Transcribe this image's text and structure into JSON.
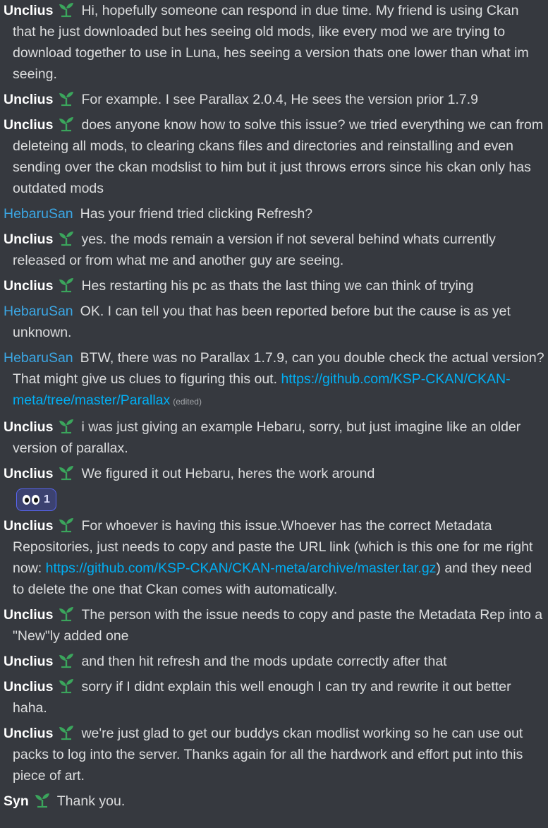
{
  "messages": [
    {
      "author": "Unclius",
      "badge": true,
      "mod": false,
      "text": "Hi, hopefully someone can respond in due time. My friend is using Ckan that he just downloaded but hes seeing old mods, like every mod we are trying to download together to use in Luna, hes seeing a version thats one lower than what im seeing."
    },
    {
      "author": "Unclius",
      "badge": true,
      "mod": false,
      "text": "For example. I see Parallax 2.0.4, He sees the version prior 1.7.9"
    },
    {
      "author": "Unclius",
      "badge": true,
      "mod": false,
      "text": "does anyone know how to solve this issue? we tried everything we can from deleteing all mods, to clearing ckans files and directories and reinstalling and even sending over the ckan modslist to him but it just throws errors since his ckan only has outdated mods"
    },
    {
      "author": "HebaruSan",
      "badge": false,
      "mod": true,
      "text": "Has your friend tried clicking Refresh?"
    },
    {
      "author": "Unclius",
      "badge": true,
      "mod": false,
      "text": "yes. the mods remain a version if not several behind whats currently released or from what me and another guy are seeing."
    },
    {
      "author": "Unclius",
      "badge": true,
      "mod": false,
      "text": "Hes restarting his pc as thats the last thing we can think of trying"
    },
    {
      "author": "HebaruSan",
      "badge": false,
      "mod": true,
      "text": "OK. I can tell you that has been reported before but the cause is as yet unknown."
    },
    {
      "author": "HebaruSan",
      "badge": false,
      "mod": true,
      "text": "BTW, there was no Parallax 1.7.9, can you double check the actual version? That might give us clues to figuring this out.",
      "link": "https://github.com/KSP-CKAN/CKAN-meta/tree/master/Parallax",
      "edited": "(edited)"
    },
    {
      "author": "Unclius",
      "badge": true,
      "mod": false,
      "text": "i was just giving an example Hebaru, sorry, but just imagine like an older version of parallax."
    },
    {
      "author": "Unclius",
      "badge": true,
      "mod": false,
      "text": "We figured it out Hebaru, heres the work around",
      "reaction": {
        "emoji": "eyes",
        "count": "1"
      }
    },
    {
      "author": "Unclius",
      "badge": true,
      "mod": false,
      "text": "For whoever is having this issue.Whoever has the correct Metadata Repositories, just needs to copy and paste the URL link (which is this one for me right now:",
      "link": "https://github.com/KSP-CKAN/CKAN-meta/archive/master.tar.gz",
      "after": ") and they need to delete the one that Ckan comes with automatically."
    },
    {
      "author": "Unclius",
      "badge": true,
      "mod": false,
      "text": "The person with the issue needs to copy and paste the Metadata Rep into a \"New\"ly added one"
    },
    {
      "author": "Unclius",
      "badge": true,
      "mod": false,
      "text": "and then hit refresh and the mods update correctly after that"
    },
    {
      "author": "Unclius",
      "badge": true,
      "mod": false,
      "text": "sorry if I didnt explain this well enough I can try and rewrite it out better haha."
    },
    {
      "author": "Unclius",
      "badge": true,
      "mod": false,
      "text": "we're just glad to get our buddys ckan modlist working so he can use out packs to log into the server. Thanks again for all the hardwork and effort put into this piece of art."
    },
    {
      "author": "Syn",
      "badge": true,
      "mod": false,
      "text": "Thank you."
    }
  ],
  "colors": {
    "background": "#36393f",
    "text": "#dcddde",
    "author": "#ffffff",
    "moderator": "#3ba7e5",
    "link": "#00aff4",
    "badge": "#3ba55c"
  },
  "icons": {
    "badge": "sprout-icon",
    "reaction": "eyes-emoji"
  }
}
